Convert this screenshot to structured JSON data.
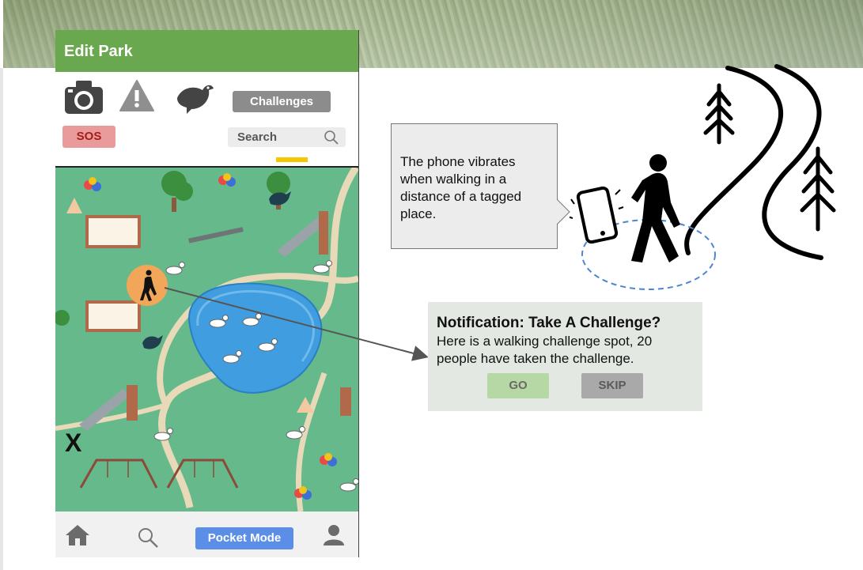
{
  "phone": {
    "title": "Edit Park",
    "challenges_label": "Challenges",
    "sos_label": "SOS",
    "search_label": "Search",
    "pocket_mode_label": "Pocket Mode",
    "close_label": "X"
  },
  "callout": {
    "text": "The phone vibrates when walking in a distance of a tagged place."
  },
  "notification": {
    "title": "Notification: Take A Challenge?",
    "body": "Here is a walking challenge spot, 20 people have taken the challenge.",
    "go_label": "GO",
    "skip_label": "SKIP"
  },
  "icons": [
    "camera-icon",
    "warning-icon",
    "bird-icon",
    "search-icon",
    "home-icon",
    "user-icon",
    "walker-icon",
    "phone-vibrate-icon",
    "pine-tree-icon"
  ],
  "colors": {
    "header_green": "#6aa84f",
    "map_green": "#66b98a",
    "sos_bg": "#e99a9a",
    "pocket_blue": "#5b8ee6",
    "go_green": "#b5d8a4",
    "walker_orange": "#f2a65a"
  }
}
